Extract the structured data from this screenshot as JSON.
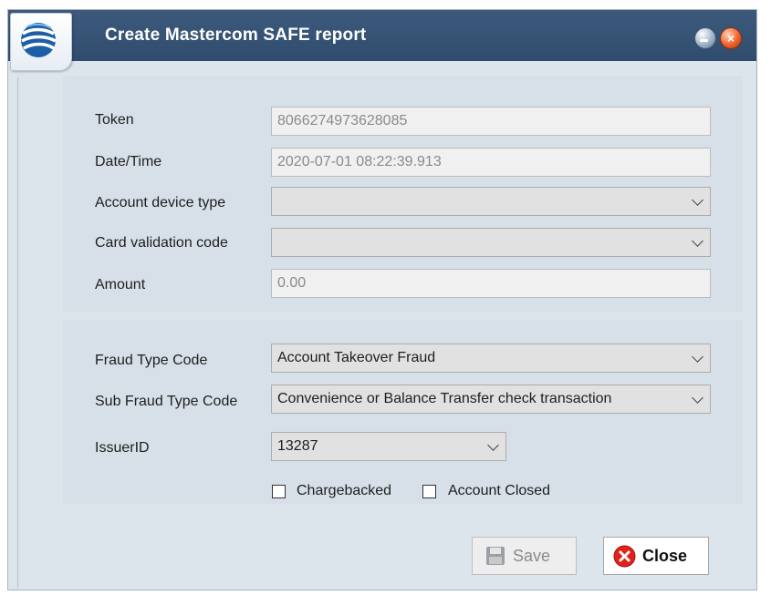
{
  "window": {
    "title": "Create Mastercom SAFE report",
    "icons": {
      "app": "globe-logo-icon",
      "minimize": "minimize-icon",
      "close": "close-x-icon"
    }
  },
  "form": {
    "token": {
      "label": "Token",
      "value": "8066274973628085"
    },
    "datetime": {
      "label": "Date/Time",
      "value": "2020-07-01 08:22:39.913"
    },
    "account_device_type": {
      "label": "Account device type",
      "value": ""
    },
    "card_validation_code": {
      "label": "Card validation code",
      "value": ""
    },
    "amount": {
      "label": "Amount",
      "value": "0.00"
    },
    "fraud_type_code": {
      "label": "Fraud Type Code",
      "value": "Account Takeover Fraud"
    },
    "sub_fraud_type_code": {
      "label": "Sub Fraud Type Code",
      "value": "Convenience or Balance Transfer check transaction"
    },
    "issuer_id": {
      "label": "IssuerID",
      "value": "13287"
    },
    "chargebacked": {
      "label": "Chargebacked",
      "checked": false
    },
    "account_closed": {
      "label": "Account Closed",
      "checked": false
    }
  },
  "buttons": {
    "save": {
      "label": "Save",
      "icon": "floppy-disk-icon"
    },
    "close": {
      "label": "Close",
      "icon": "red-x-icon"
    }
  },
  "colors": {
    "titlebar": "#304c6d",
    "dialog_bg": "#dde5ec",
    "close_icon": "#e0221b"
  }
}
